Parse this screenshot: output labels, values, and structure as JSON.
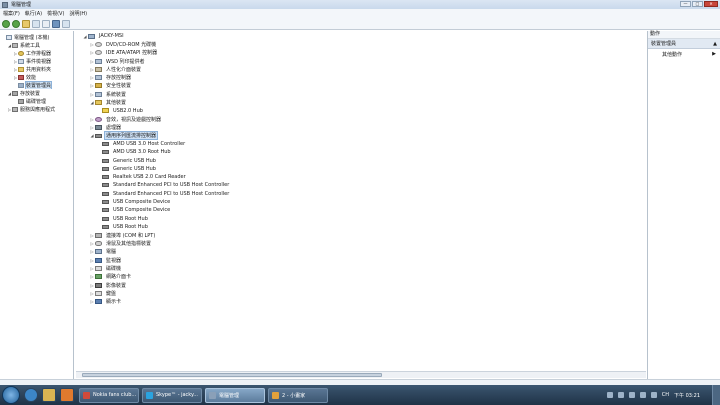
{
  "window": {
    "title": "電腦管理",
    "controls": [
      "—",
      "□",
      "✕"
    ]
  },
  "menu": [
    "檔案(F)",
    "執行(A)",
    "檢視(V)",
    "說明(H)"
  ],
  "left_tree": [
    {
      "label": "電腦管理 (本機)",
      "depth": 0,
      "icon": "computer-management",
      "expander": ""
    },
    {
      "label": "系統工具",
      "depth": 1,
      "icon": "tools",
      "expander": "◢"
    },
    {
      "label": "工作排程器",
      "depth": 2,
      "icon": "clock",
      "expander": "▷"
    },
    {
      "label": "事件檢視器",
      "depth": 2,
      "icon": "event",
      "expander": "▷"
    },
    {
      "label": "共用資料夾",
      "depth": 2,
      "icon": "folder",
      "expander": "▷"
    },
    {
      "label": "效能",
      "depth": 2,
      "icon": "perf",
      "expander": "▷"
    },
    {
      "label": "裝置管理員",
      "depth": 2,
      "icon": "dev",
      "expander": "",
      "selected": true
    },
    {
      "label": "存放裝置",
      "depth": 1,
      "icon": "disk",
      "expander": "◢"
    },
    {
      "label": "磁碟管理",
      "depth": 2,
      "icon": "disk",
      "expander": ""
    },
    {
      "label": "服務與應用程式",
      "depth": 1,
      "icon": "svc",
      "expander": "▷"
    }
  ],
  "device_tree": [
    {
      "label": "JACKY-MSI",
      "depth": 0,
      "icon": "pc",
      "expander": "◢"
    },
    {
      "label": "DVD/CD-ROM 光碟機",
      "depth": 1,
      "icon": "cd",
      "expander": "▷"
    },
    {
      "label": "IDE ATA/ATAPI 控制器",
      "depth": 1,
      "icon": "cd",
      "expander": "▷"
    },
    {
      "label": "WSD 列印提供者",
      "depth": 1,
      "icon": "sys",
      "expander": "▷"
    },
    {
      "label": "人性化介面裝置",
      "depth": 1,
      "icon": "hid",
      "expander": "▷"
    },
    {
      "label": "存放控制器",
      "depth": 1,
      "icon": "sys",
      "expander": "▷"
    },
    {
      "label": "安全性裝置",
      "depth": 1,
      "icon": "sec",
      "expander": "▷"
    },
    {
      "label": "系統裝置",
      "depth": 1,
      "icon": "sys",
      "expander": "▷"
    },
    {
      "label": "其他裝置",
      "depth": 1,
      "icon": "other",
      "expander": "◢"
    },
    {
      "label": "USB2.0 Hub",
      "depth": 2,
      "icon": "warn",
      "expander": ""
    },
    {
      "label": "音效，視訊及遊戲控制器",
      "depth": 1,
      "icon": "audio",
      "expander": "▷"
    },
    {
      "label": "處理器",
      "depth": 1,
      "icon": "cpu",
      "expander": "▷"
    },
    {
      "label": "通用序列匯流排控制器",
      "depth": 1,
      "icon": "usb",
      "expander": "◢",
      "selected": true
    },
    {
      "label": "AMD USB 3.0 Host Controller",
      "depth": 2,
      "icon": "usb",
      "expander": ""
    },
    {
      "label": "AMD USB 3.0 Root Hub",
      "depth": 2,
      "icon": "usb",
      "expander": ""
    },
    {
      "label": "Generic USB Hub",
      "depth": 2,
      "icon": "usb",
      "expander": ""
    },
    {
      "label": "Generic USB Hub",
      "depth": 2,
      "icon": "usb",
      "expander": ""
    },
    {
      "label": "Realtek USB 2.0 Card Reader",
      "depth": 2,
      "icon": "usb",
      "expander": ""
    },
    {
      "label": "Standard Enhanced PCI to USB Host Controller",
      "depth": 2,
      "icon": "usb",
      "expander": ""
    },
    {
      "label": "Standard Enhanced PCI to USB Host Controller",
      "depth": 2,
      "icon": "usb",
      "expander": ""
    },
    {
      "label": "USB Composite Device",
      "depth": 2,
      "icon": "usb",
      "expander": ""
    },
    {
      "label": "USB Composite Device",
      "depth": 2,
      "icon": "usb",
      "expander": ""
    },
    {
      "label": "USB Root Hub",
      "depth": 2,
      "icon": "usb",
      "expander": ""
    },
    {
      "label": "USB Root Hub",
      "depth": 2,
      "icon": "usb",
      "expander": ""
    },
    {
      "label": "連接埠 (COM 和 LPT)",
      "depth": 1,
      "icon": "port",
      "expander": "▷"
    },
    {
      "label": "滑鼠及其他指標裝置",
      "depth": 1,
      "icon": "mouse",
      "expander": "▷"
    },
    {
      "label": "電腦",
      "depth": 1,
      "icon": "pc",
      "expander": "▷"
    },
    {
      "label": "監視器",
      "depth": 1,
      "icon": "mon",
      "expander": "▷"
    },
    {
      "label": "磁碟機",
      "depth": 1,
      "icon": "kb",
      "expander": "▷"
    },
    {
      "label": "網路介面卡",
      "depth": 1,
      "icon": "net",
      "expander": "▷"
    },
    {
      "label": "影像裝置",
      "depth": 1,
      "icon": "cam",
      "expander": "▷"
    },
    {
      "label": "鍵盤",
      "depth": 1,
      "icon": "kb",
      "expander": "▷"
    },
    {
      "label": "顯示卡",
      "depth": 1,
      "icon": "mon",
      "expander": "▷"
    }
  ],
  "actions_pane": {
    "header": "動作",
    "section": "裝置管理員",
    "section_arrow": "▲",
    "item": "其他動作",
    "item_arrow": "▶"
  },
  "taskbar": {
    "tasks": [
      {
        "label": "Nokia fans club...",
        "color": "#d04a3a",
        "active": false
      },
      {
        "label": "Skype™ - jacky...",
        "color": "#2aa3e0",
        "active": false
      },
      {
        "label": "電腦管理",
        "color": "#8aa0b8",
        "active": true
      },
      {
        "label": "2 - 小畫家",
        "color": "#e2a13b",
        "active": false
      }
    ],
    "lang": "CH",
    "clock": "下午 03:21"
  },
  "colors": {
    "accent": "#2b4a6a",
    "selection": "#cfe2f7"
  }
}
